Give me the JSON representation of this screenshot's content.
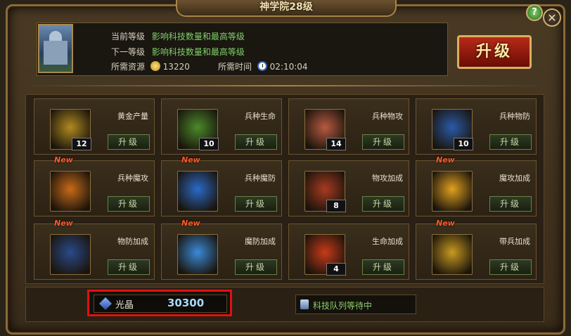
{
  "window": {
    "title": "神学院28级",
    "help_label": "?",
    "close_label": "✕"
  },
  "header": {
    "current_level_label": "当前等级",
    "current_level_value": "影响科技数量和最高等级",
    "next_level_label": "下一等级",
    "next_level_value": "影响科技数量和最高等级",
    "resource_label": "所需资源",
    "resource_icon": "gold-coin-icon",
    "resource_value": "13220",
    "time_label": "所需时间",
    "time_icon": "clock-icon",
    "time_value": "02:10:04",
    "upgrade_button": "升级"
  },
  "techs": [
    {
      "name": "黄金产量",
      "level": "12",
      "is_new": false,
      "button": "升级",
      "icon": "gold-coins-icon",
      "color": "#b08a20"
    },
    {
      "name": "兵种生命",
      "level": "10",
      "is_new": false,
      "button": "升级",
      "icon": "golden-warrior-icon",
      "color": "#4a8a2a"
    },
    {
      "name": "兵种物攻",
      "level": "14",
      "is_new": false,
      "button": "升级",
      "icon": "war-drum-icon",
      "color": "#b85a40"
    },
    {
      "name": "兵种物防",
      "level": "10",
      "is_new": false,
      "button": "升级",
      "icon": "shield-icon",
      "color": "#2a5aa8"
    },
    {
      "name": "兵种魔攻",
      "level": "",
      "is_new": true,
      "button": "升级",
      "icon": "fire-spear-icon",
      "color": "#c86a18"
    },
    {
      "name": "兵种魔防",
      "level": "",
      "is_new": true,
      "button": "升级",
      "icon": "magic-shield-icon",
      "color": "#2a6ac8"
    },
    {
      "name": "物攻加成",
      "level": "8",
      "is_new": false,
      "button": "升级",
      "icon": "spear-icon",
      "color": "#a83a20"
    },
    {
      "name": "魔攻加成",
      "level": "",
      "is_new": true,
      "button": "升级",
      "icon": "magic-burst-icon",
      "color": "#e0a020"
    },
    {
      "name": "物防加成",
      "level": "",
      "is_new": true,
      "button": "升级",
      "icon": "cannon-icon",
      "color": "#2a4a8a"
    },
    {
      "name": "魔防加成",
      "level": "",
      "is_new": true,
      "button": "升级",
      "icon": "crystal-orb-icon",
      "color": "#3a8ad8"
    },
    {
      "name": "生命加成",
      "level": "4",
      "is_new": false,
      "button": "升级",
      "icon": "pagoda-icon",
      "color": "#c83a18"
    },
    {
      "name": "带兵加成",
      "level": "",
      "is_new": true,
      "button": "升级",
      "icon": "golden-book-icon",
      "color": "#c89a20"
    }
  ],
  "new_badge": "New",
  "footer": {
    "crystal_label": "光晶",
    "crystal_value": "30300",
    "queue_text": "科技队列等待中"
  }
}
